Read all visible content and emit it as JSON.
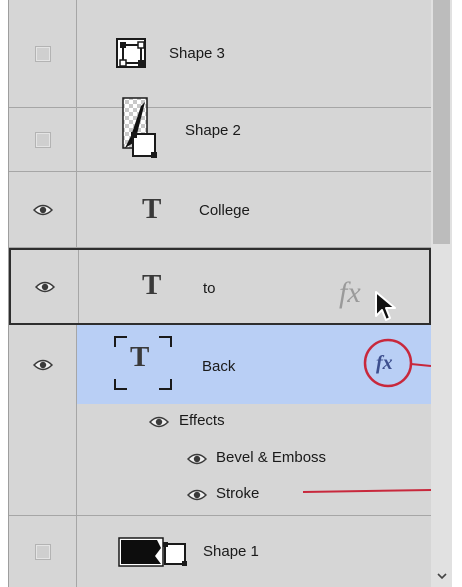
{
  "layers": [
    {
      "name": "Shape 3",
      "visible": false,
      "kind": "shape",
      "thumb_icon": "shape-layer-thumbnail-icon"
    },
    {
      "name": "Shape 2",
      "visible": false,
      "kind": "shape",
      "thumb_icon": "shape-mask-thumbnail-icon"
    },
    {
      "name": "College",
      "visible": true,
      "kind": "text",
      "thumb_icon": "type-layer-icon"
    },
    {
      "name": "to",
      "visible": true,
      "kind": "text",
      "thumb_icon": "type-layer-icon",
      "state": "hover-outlined"
    },
    {
      "name": "Back",
      "visible": true,
      "kind": "text",
      "thumb_icon": "type-layer-icon",
      "state": "selected",
      "effects": {
        "header": "Effects",
        "items": [
          "Bevel & Emboss",
          "Stroke"
        ]
      }
    },
    {
      "name": "Shape 1",
      "visible": false,
      "kind": "shape",
      "thumb_icon": "shape-layer-thumbnail-icon"
    }
  ],
  "fx_badge": "fx",
  "icons": {
    "visibility": "eye-icon",
    "type_layer": "T",
    "cursor": "mouse-pointer-icon",
    "scroll_down": "scroll-down-arrow-icon"
  },
  "colors": {
    "panel_bg": "#d6d6d6",
    "selected_row": "#b9cff5",
    "annotation_red": "#c8283c",
    "fx_text": "#3d4f8e",
    "divider": "#a6a6a6"
  }
}
